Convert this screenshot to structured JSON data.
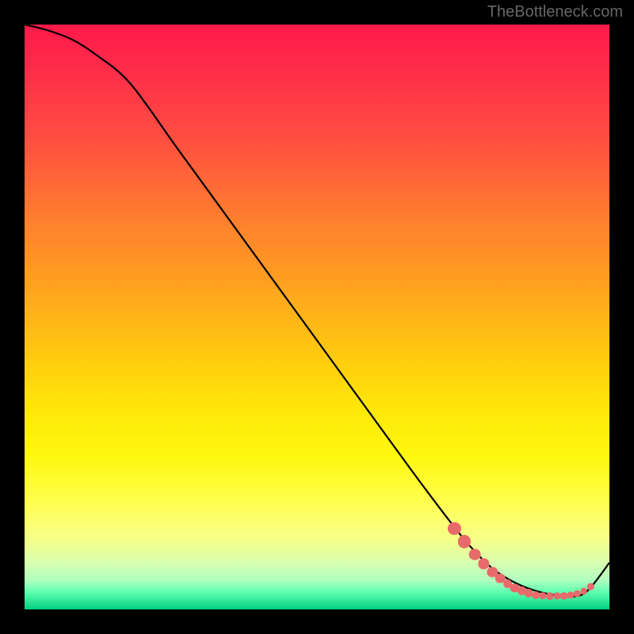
{
  "watermark": "TheBottleneck.com",
  "chart_data": {
    "type": "line",
    "title": "",
    "xlabel": "",
    "ylabel": "",
    "xlim": [
      0,
      100
    ],
    "ylim": [
      0,
      100
    ],
    "grid": false,
    "series": [
      {
        "name": "bottleneck-curve",
        "color": "#000000",
        "x": [
          0,
          4,
          8,
          12,
          18,
          26,
          34,
          42,
          50,
          58,
          66,
          72,
          76,
          80,
          84,
          88,
          92,
          95,
          97,
          100
        ],
        "y": [
          100,
          99,
          97.5,
          95,
          90,
          79,
          68,
          57,
          46,
          35,
          24,
          16,
          11,
          7,
          4.5,
          3,
          2.3,
          2.4,
          4,
          8
        ]
      }
    ],
    "markers": [
      {
        "x": 73.5,
        "y": 13.8,
        "r": 1.1
      },
      {
        "x": 75.2,
        "y": 11.6,
        "r": 1.1
      },
      {
        "x": 77.0,
        "y": 9.4,
        "r": 1.0
      },
      {
        "x": 78.5,
        "y": 7.8,
        "r": 0.9
      },
      {
        "x": 80.0,
        "y": 6.4,
        "r": 0.9
      },
      {
        "x": 81.3,
        "y": 5.3,
        "r": 0.85
      },
      {
        "x": 82.6,
        "y": 4.4,
        "r": 0.8
      },
      {
        "x": 83.8,
        "y": 3.7,
        "r": 0.75
      },
      {
        "x": 85.0,
        "y": 3.2,
        "r": 0.7
      },
      {
        "x": 86.2,
        "y": 2.8,
        "r": 0.7
      },
      {
        "x": 87.4,
        "y": 2.5,
        "r": 0.68
      },
      {
        "x": 88.6,
        "y": 2.35,
        "r": 0.65
      },
      {
        "x": 89.8,
        "y": 2.3,
        "r": 0.65
      },
      {
        "x": 91.0,
        "y": 2.3,
        "r": 0.62
      },
      {
        "x": 92.2,
        "y": 2.35,
        "r": 0.62
      },
      {
        "x": 93.4,
        "y": 2.5,
        "r": 0.62
      },
      {
        "x": 94.5,
        "y": 2.7,
        "r": 0.6
      },
      {
        "x": 95.6,
        "y": 3.1,
        "r": 0.6
      },
      {
        "x": 96.8,
        "y": 3.9,
        "r": 0.58
      }
    ]
  }
}
